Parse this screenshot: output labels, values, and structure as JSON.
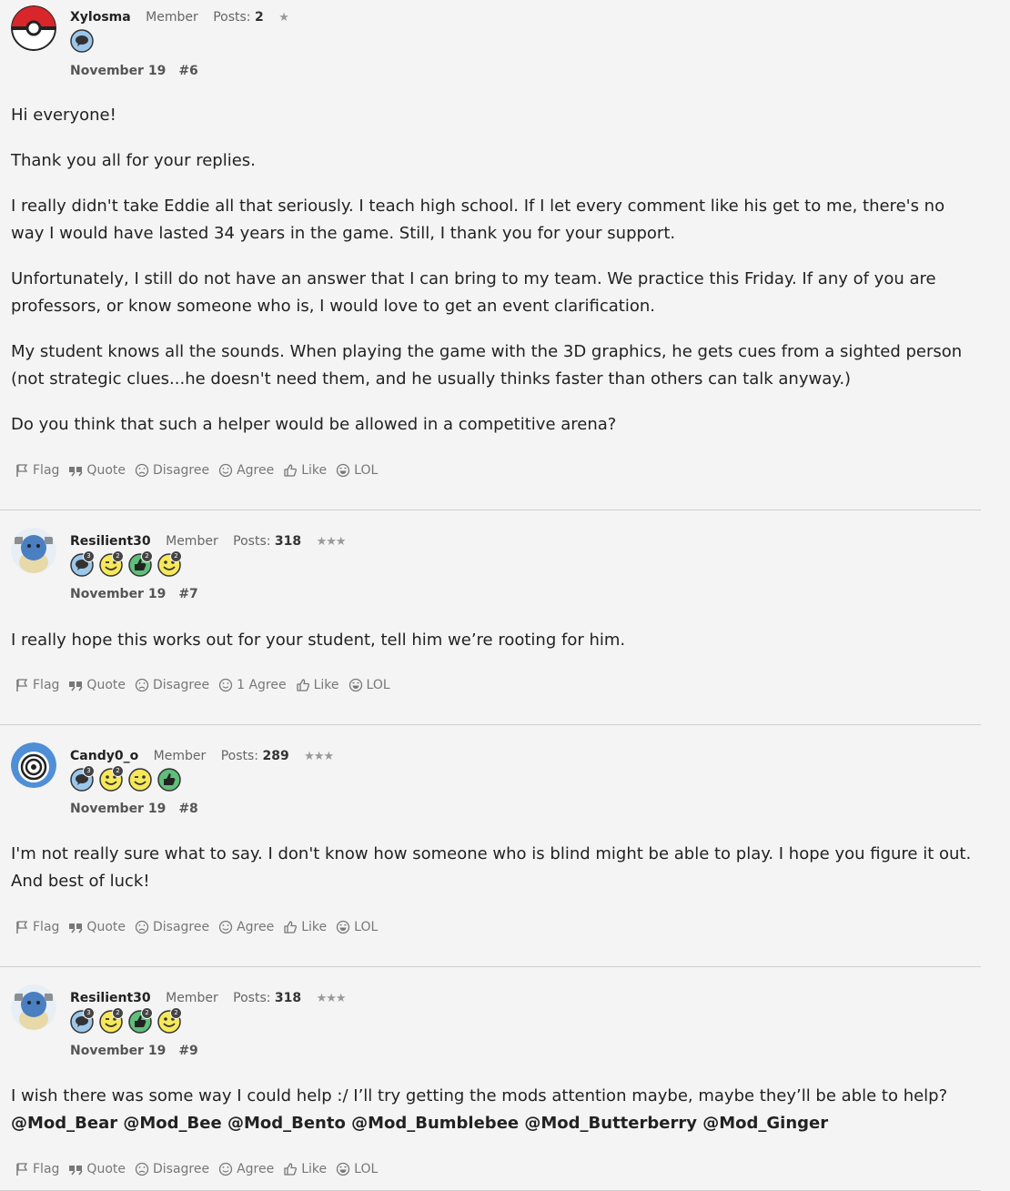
{
  "posts": [
    {
      "username": "Xylosma",
      "role": "Member",
      "posts_label": "Posts:",
      "posts_count": "2",
      "stars": "★",
      "date": "November 19",
      "number": "#6",
      "paragraphs": [
        "Hi everyone!",
        "Thank you all for your replies.",
        "I really didn't take Eddie all that seriously. I teach high school. If I let every comment like his get to me, there's no way I would have lasted 34 years in the game. Still, I thank you for your support.",
        "Unfortunately, I still do not have an answer that I can bring to my team. We practice this Friday. If any of you are professors, or know someone who is, I would love to get an event clarification.",
        "My student knows all the sounds. When playing the game with the 3D graphics, he gets cues from a sighted person (not strategic clues...he doesn't need them, and he usually thinks faster than others can talk anyway.)",
        "Do you think that such a helper would be allowed in a competitive arena?"
      ],
      "actions": [
        "Flag",
        "Quote",
        "Disagree",
        "Agree",
        "Like",
        "LOL"
      ]
    },
    {
      "username": "Resilient30",
      "role": "Member",
      "posts_label": "Posts:",
      "posts_count": "318",
      "stars": "★★★",
      "badge_counts": [
        "3",
        "2",
        "2",
        "2"
      ],
      "date": "November 19",
      "number": "#7",
      "paragraphs": [
        "I really hope this works out for your student, tell him we’re rooting for him."
      ],
      "actions": [
        "Flag",
        "Quote",
        "Disagree",
        "1 Agree",
        "Like",
        "LOL"
      ]
    },
    {
      "username": "Candy0_o",
      "role": "Member",
      "posts_label": "Posts:",
      "posts_count": "289",
      "stars": "★★★",
      "badge_counts": [
        "3",
        "2"
      ],
      "date": "November 19",
      "number": "#8",
      "paragraphs": [
        "I'm not really sure what to say. I don't know how someone who is blind might be able to play. I hope you figure it out. And best of luck!"
      ],
      "actions": [
        "Flag",
        "Quote",
        "Disagree",
        "Agree",
        "Like",
        "LOL"
      ]
    },
    {
      "username": "Resilient30",
      "role": "Member",
      "posts_label": "Posts:",
      "posts_count": "318",
      "stars": "★★★",
      "badge_counts": [
        "3",
        "2",
        "2",
        "2"
      ],
      "date": "November 19",
      "number": "#9",
      "paragraphs": [
        "I wish there was some way I could help :/ I’ll try getting the mods attention maybe, maybe they’ll be able to help?"
      ],
      "mentions": "@Mod_Bear @Mod_Bee @Mod_Bento @Mod_Bumblebee @Mod_Butterberry @Mod_Ginger",
      "actions": [
        "Flag",
        "Quote",
        "Disagree",
        "Agree",
        "Like",
        "LOL"
      ]
    }
  ]
}
